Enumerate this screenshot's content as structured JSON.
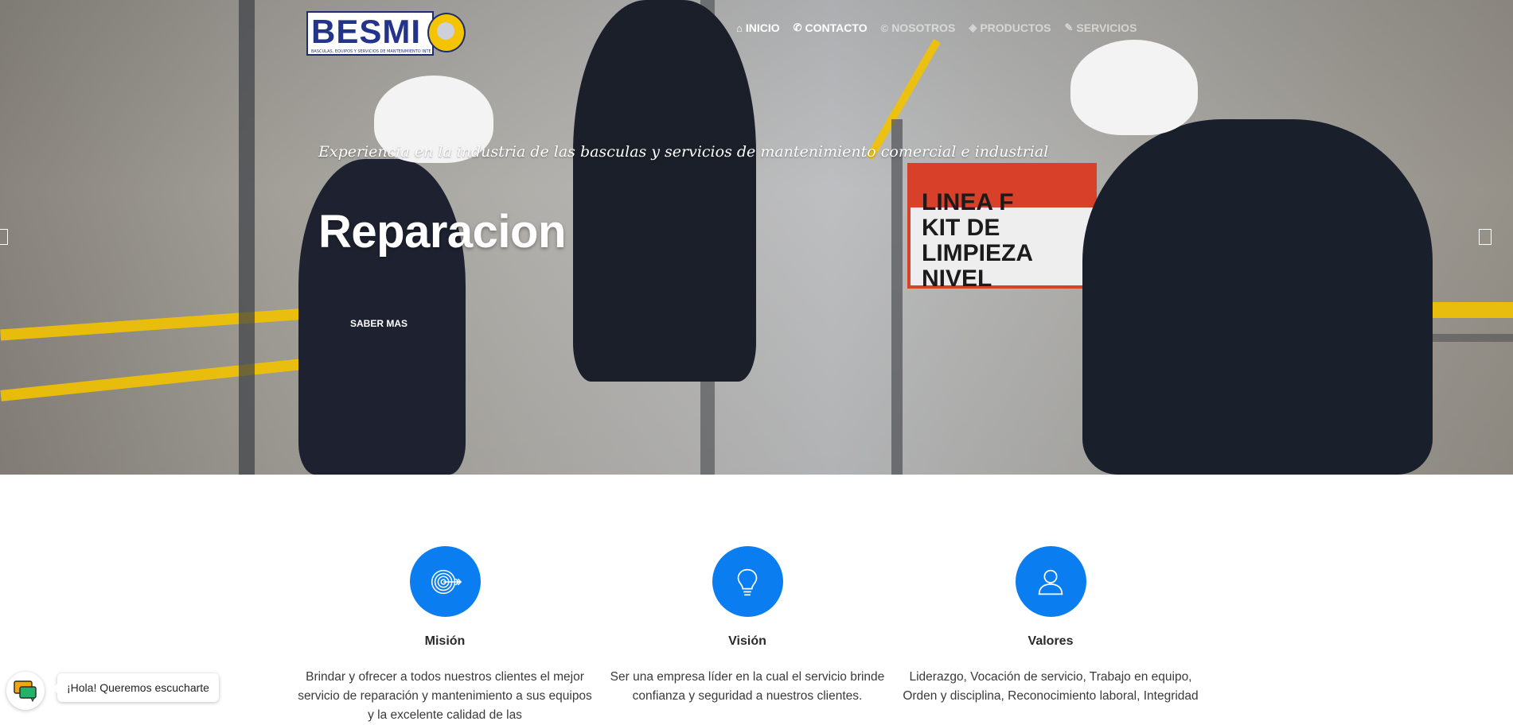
{
  "brand": {
    "logo_text": "BESMI",
    "logo_tagline": "BASCULAS, EQUIPOS Y SERVICIOS DE MANTENIMIENTO INTEGRAL"
  },
  "nav": {
    "items": [
      {
        "label": "INICIO",
        "icon": "home-icon",
        "glyph": "⌂"
      },
      {
        "label": "CONTACTO",
        "icon": "phone-icon",
        "glyph": "✆"
      },
      {
        "label": "NOSOTROS",
        "icon": "copyright-icon",
        "glyph": "©"
      },
      {
        "label": "PRODUCTOS",
        "icon": "tag-icon",
        "glyph": "◈"
      },
      {
        "label": "SERVICIOS",
        "icon": "wrench-icon",
        "glyph": "✎"
      }
    ]
  },
  "hero": {
    "tagline": "Experiencia en la industria de las basculas y servicios de mantenimiento comercial e industrial",
    "title": "Reparacion",
    "cta_label": "SABER MAS",
    "sign_text": "LINEA F\nKIT DE LIMPIEZA\nNIVEL"
  },
  "features": [
    {
      "title": "Misión",
      "icon": "target-icon",
      "text": "Brindar y ofrecer a todos nuestros clientes el mejor servicio de reparación y mantenimiento a sus equipos y la excelente calidad de las"
    },
    {
      "title": "Visión",
      "icon": "lightbulb-icon",
      "text": "Ser una empresa líder en la cual el servicio brinde confianza y seguridad a nuestros clientes."
    },
    {
      "title": "Valores",
      "icon": "user-icon",
      "text": "Liderazgo, Vocación de servicio, Trabajo en equipo, Orden y disciplina, Reconocimiento laboral, Integridad"
    }
  ],
  "chat": {
    "label": "¡Hola! Queremos escucharte"
  },
  "colors": {
    "accent": "#0a7ef0",
    "brand_blue": "#24348a",
    "brand_yellow": "#f5c400"
  }
}
